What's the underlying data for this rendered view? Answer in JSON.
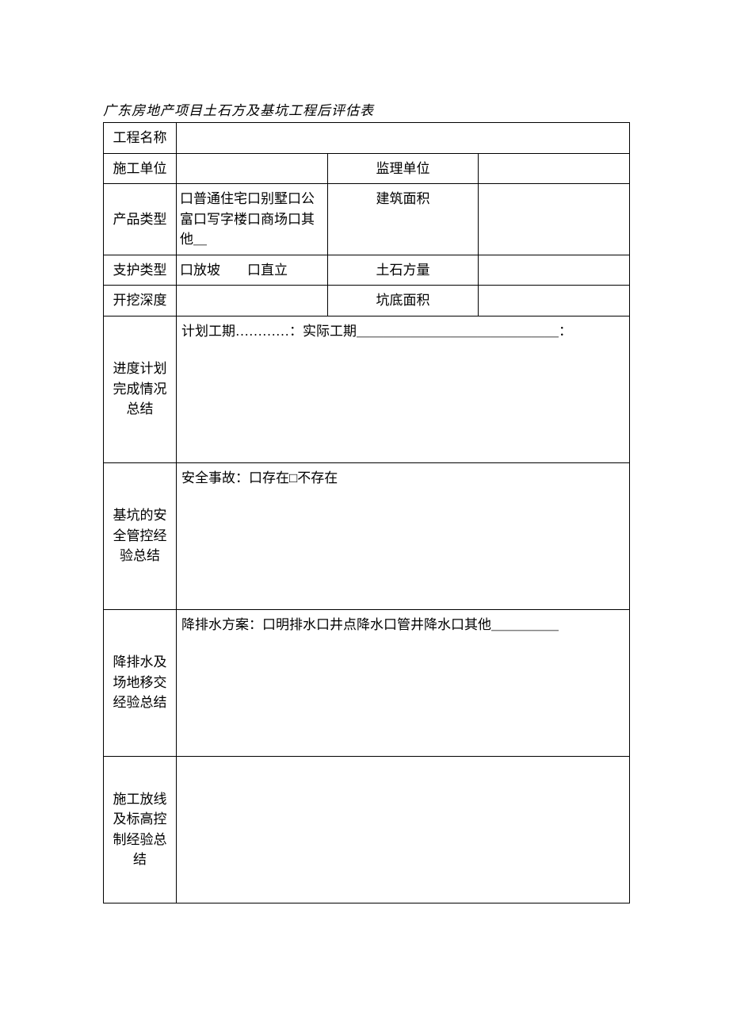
{
  "title": "广东房地产项目土石方及基坑工程后评估表",
  "rows": {
    "project_name": {
      "label": "工程名称",
      "value": ""
    },
    "construction_unit": {
      "label": "施工单位",
      "value": ""
    },
    "supervision_unit": {
      "label": "监理单位",
      "value": ""
    },
    "product_type": {
      "label": "产品类型",
      "value": "口普通住宅口别墅口公富口写字楼口商场口其他＿"
    },
    "building_area": {
      "label": "建筑面积",
      "value": ""
    },
    "support_type": {
      "label": "支护类型",
      "value": "口放坡  口直立"
    },
    "earth_volume": {
      "label": "土石方量",
      "value": ""
    },
    "excavation_depth": {
      "label": "开挖深度",
      "value": ""
    },
    "pit_bottom_area": {
      "label": "坑底面积",
      "value": ""
    }
  },
  "sections": {
    "progress": {
      "label": "进度计划完成情况总结",
      "header": "计划工期…………：实际工期＿＿＿＿＿＿＿＿＿＿＿＿＿＿＿："
    },
    "safety": {
      "label": "基坑的安全管控经验总结",
      "header": "安全事故：口存在□不存在"
    },
    "dewatering": {
      "label": "降排水及场地移交经验总结",
      "header": "降排水方案：口明排水口井点降水口管井降水口其他＿＿＿＿＿"
    },
    "setting_out": {
      "label": "施工放线及标高控制经验总结",
      "header": ""
    }
  }
}
